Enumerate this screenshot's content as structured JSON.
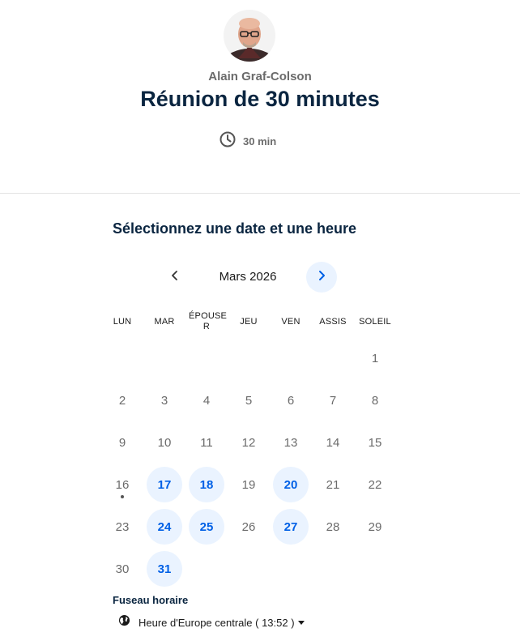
{
  "header": {
    "host_name": "Alain Graf-Colson",
    "event_title": "Réunion de 30 minutes",
    "duration": "30 min",
    "duration_icon": "clock-icon"
  },
  "picker": {
    "title": "Sélectionnez une date et une heure",
    "month_label": "Mars 2026",
    "prev_icon": "chevron-left-icon",
    "next_icon": "chevron-right-icon",
    "weekdays": [
      "LUN",
      "MAR",
      "ÉPOUSE R",
      "JEU",
      "VEN",
      "ASSIS",
      "SOLEIL"
    ],
    "leading_blanks": 6,
    "days": [
      "1",
      "2",
      "3",
      "4",
      "5",
      "6",
      "7",
      "8",
      "9",
      "10",
      "11",
      "12",
      "13",
      "14",
      "15",
      "16",
      "17",
      "18",
      "19",
      "20",
      "21",
      "22",
      "23",
      "24",
      "25",
      "26",
      "27",
      "28",
      "29",
      "30",
      "31"
    ],
    "available_days": [
      "17",
      "18",
      "20",
      "24",
      "25",
      "27",
      "31"
    ],
    "today": "16"
  },
  "timezone": {
    "label": "Fuseau horaire",
    "value": "Heure d'Europe centrale ( 13:52 )",
    "icon": "globe-icon"
  },
  "colors": {
    "accent": "#0060e6",
    "accent_bg": "#eaf3ff",
    "title": "#0a2540",
    "muted": "#6b6b6b"
  }
}
